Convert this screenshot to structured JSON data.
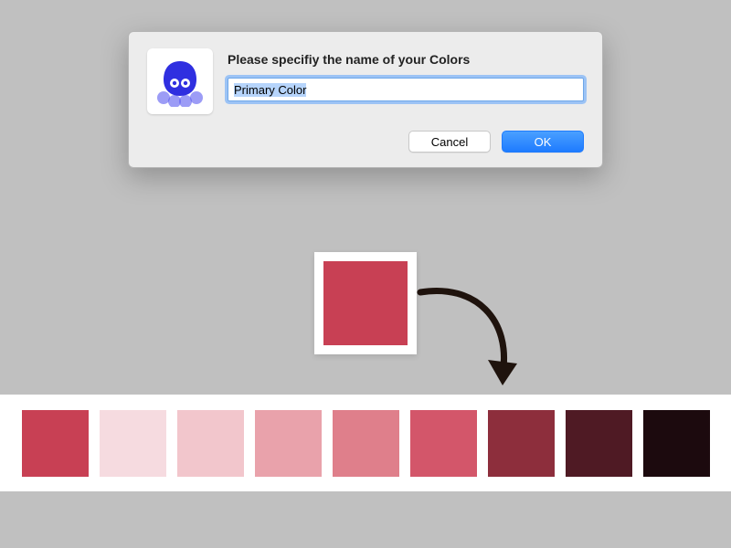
{
  "dialog": {
    "title": "Please specifiy the name of your Colors",
    "input_value": "Primary Color",
    "cancel_label": "Cancel",
    "ok_label": "OK"
  },
  "source_color": "#c84054",
  "palette": [
    "#c84054",
    "#f6dbe0",
    "#f2c6cc",
    "#e9a2ab",
    "#df7f8b",
    "#d3566a",
    "#8d2e3c",
    "#4f1a24",
    "#1c0a0e"
  ]
}
